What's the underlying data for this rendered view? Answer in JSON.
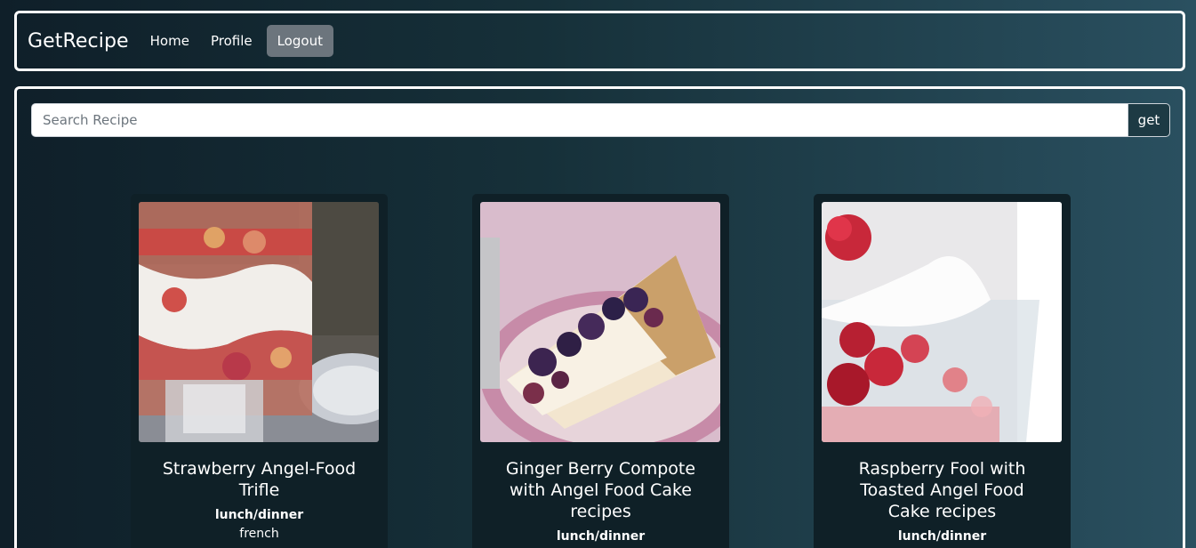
{
  "navbar": {
    "brand": "GetRecipe",
    "links": [
      {
        "label": "Home"
      },
      {
        "label": "Profile"
      },
      {
        "label": "Logout"
      }
    ]
  },
  "search": {
    "placeholder": "Search Recipe",
    "value": "",
    "button_label": "get"
  },
  "recipes": [
    {
      "title": "Strawberry Angel-Food Trifle",
      "meal_type": "lunch/dinner",
      "cuisine": "french",
      "image": "strawberry-trifle-photo"
    },
    {
      "title": "Ginger Berry Compote with Angel Food Cake recipes",
      "meal_type": "lunch/dinner",
      "cuisine": "",
      "image": "berry-compote-cake-photo"
    },
    {
      "title": "Raspberry Fool with Toasted Angel Food Cake recipes",
      "meal_type": "lunch/dinner",
      "cuisine": "",
      "image": "raspberry-fool-photo"
    }
  ],
  "colors": {
    "background_dark": "#0f1f29",
    "background_light": "#2a5060",
    "card_background": "#0f2027",
    "active_nav": "#6c757d",
    "border": "#ffffff"
  }
}
